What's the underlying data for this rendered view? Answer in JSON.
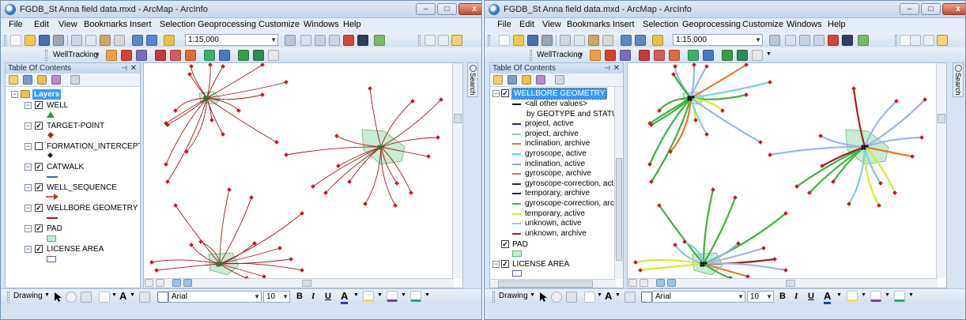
{
  "windows": [
    {
      "title": "FGDB_St Anna field data.mxd - ArcMap - ArcInfo",
      "controls": {
        "minimize": "–",
        "maximize": "□",
        "close": "x"
      },
      "menu": [
        "File",
        "Edit",
        "View",
        "Bookmarks",
        "Insert",
        "Selection",
        "Geoprocessing",
        "Customize",
        "Windows",
        "Help"
      ],
      "scale": "1:15,000",
      "toolbar_label": "WellTracking",
      "toc_title": "Table Of Contents",
      "layers_root": "Layers",
      "layers": [
        {
          "label": "WELL",
          "checked": true,
          "symbol": "green-triangle"
        },
        {
          "label": "TARGET-POINT",
          "checked": true,
          "symbol": "red-diamond"
        },
        {
          "label": "FORMATION_INTERCEPTS",
          "checked": false,
          "symbol": "black-diamond"
        },
        {
          "label": "CATWALK",
          "checked": true,
          "symbol": "blue-line"
        },
        {
          "label": "WELL_SEQUENCE",
          "checked": true,
          "symbol": "red-arrow"
        },
        {
          "label": "WELLBORE GEOMETRY",
          "checked": true,
          "symbol": "red-line"
        },
        {
          "label": "PAD",
          "checked": true,
          "symbol": "green-fill"
        },
        {
          "label": "LICENSE AREA",
          "checked": true,
          "symbol": "purple-outline"
        }
      ],
      "drawing_label": "Drawing",
      "font_name": "Arial",
      "font_size": "10",
      "format_buttons": [
        "B",
        "I",
        "U"
      ],
      "search_tab": "Search"
    },
    {
      "title": "FGDB_St Anna field data.mxd - ArcMap - ArcInfo",
      "controls": {
        "minimize": "–",
        "maximize": "□",
        "close": "x"
      },
      "menu": [
        "File",
        "Edit",
        "View",
        "Bookmarks",
        "Insert",
        "Selection",
        "Geoprocessing",
        "Customize",
        "Windows",
        "Help"
      ],
      "scale": "1:15,000",
      "toolbar_label": "WellTracking",
      "toc_title": "Table Of Contents",
      "selected_layer": "WELLBORE GEOMETRY",
      "legend_items": [
        {
          "label": "<all other values>",
          "color": "#000000"
        },
        {
          "label": "by GEOTYPE and STATUS",
          "color": ""
        },
        {
          "label": "project, active",
          "color": "#1f1fb4"
        },
        {
          "label": "project, archive",
          "color": "#9ab6e6"
        },
        {
          "label": "inclination, archive",
          "color": "#e07b2a"
        },
        {
          "label": "gyroscope, active",
          "color": "#50d8d0"
        },
        {
          "label": "inclination, active",
          "color": "#8f9ee8"
        },
        {
          "label": "gyroscope, archive",
          "color": "#c07a5a"
        },
        {
          "label": "gyroscope-correction, active",
          "color": "#2a2a2a"
        },
        {
          "label": "temporary, archive",
          "color": "#1a2a6a"
        },
        {
          "label": "gyroscope-correction, archive",
          "color": "#3cb43c"
        },
        {
          "label": "temporary, active",
          "color": "#d8e83a"
        },
        {
          "label": "unknown, active",
          "color": "#7ad0e0"
        },
        {
          "label": "unknown, archive",
          "color": "#a0201e"
        }
      ],
      "other_layers": [
        {
          "label": "PAD",
          "checked": true,
          "symbol": "green-fill"
        },
        {
          "label": "LICENSE AREA",
          "checked": true,
          "symbol": "purple-outline"
        }
      ],
      "drawing_label": "Drawing",
      "font_name": "Arial",
      "font_size": "10",
      "format_buttons": [
        "B",
        "I",
        "U"
      ],
      "search_tab": "Search"
    }
  ],
  "colors": {
    "well_red": "#a01818",
    "target_red": "#c41c1c",
    "pad_green": "#c8ecd2",
    "license_purple": "#6a5aa8",
    "selection_blue": "#3399ff"
  }
}
